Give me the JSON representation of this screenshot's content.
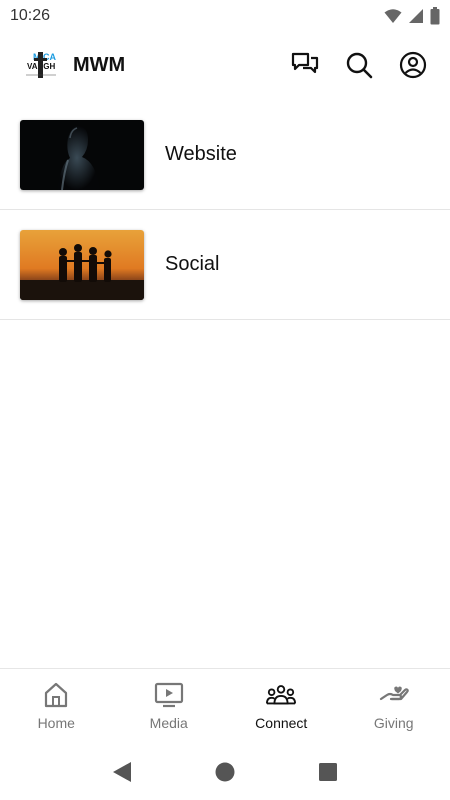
{
  "status_bar": {
    "time": "10:26"
  },
  "header": {
    "title": "MWM",
    "logo_text_top": "MICA",
    "logo_text_bottom": "VAUGH",
    "accent_color": "#1a9be0"
  },
  "icons": {
    "chat": "chat-bubbles-icon",
    "search": "search-icon",
    "account": "account-circle-icon"
  },
  "items": [
    {
      "label": "Website",
      "thumbnail": "person-in-dark-photo"
    },
    {
      "label": "Social",
      "thumbnail": "people-at-sunset-photo"
    }
  ],
  "bottom_nav": {
    "active": "Connect",
    "tabs": [
      {
        "label": "Home",
        "icon": "home-icon"
      },
      {
        "label": "Media",
        "icon": "tv-play-icon"
      },
      {
        "label": "Connect",
        "icon": "group-icon"
      },
      {
        "label": "Giving",
        "icon": "hand-heart-icon"
      }
    ]
  },
  "system_nav": {
    "back": "back-triangle-icon",
    "home": "home-circle-icon",
    "recents": "recents-square-icon"
  }
}
